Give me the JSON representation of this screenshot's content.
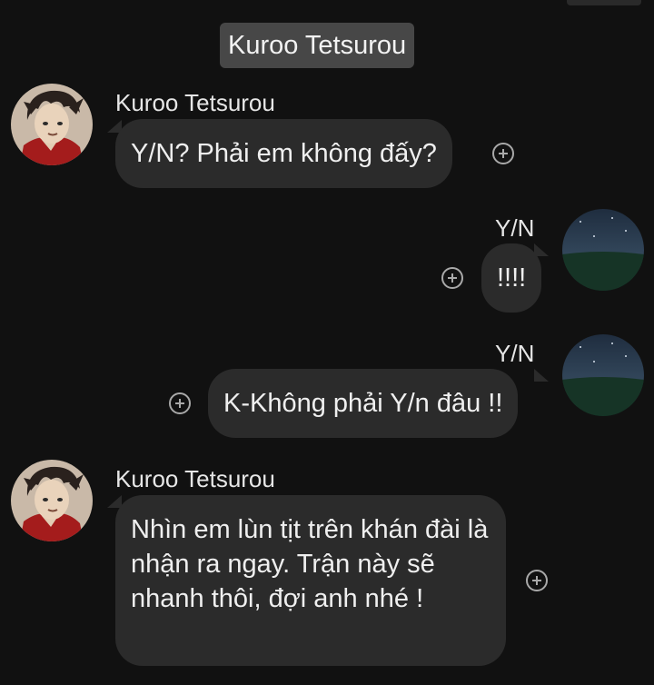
{
  "header": {
    "title": "Kuroo Tetsurou"
  },
  "messages": [
    {
      "sender": "Kuroo Tetsurou",
      "text": "Y/N? Phải em không đấy?",
      "side": "left",
      "avatar_icon": "kuroo-avatar-icon"
    },
    {
      "sender": "Y/N",
      "text": "!!!!",
      "side": "right",
      "avatar_icon": "night-sky-avatar-icon"
    },
    {
      "sender": "Y/N",
      "text": "K-Không phải Y/n đâu !!",
      "side": "right",
      "avatar_icon": "night-sky-avatar-icon"
    },
    {
      "sender": "Kuroo Tetsurou",
      "text": "Nhìn em lùn tịt trên khán đài là nhận ra ngay. Trận này sẽ nhanh thôi, đợi anh nhé !",
      "side": "left",
      "avatar_icon": "kuroo-avatar-icon"
    }
  ],
  "colors": {
    "background": "#111111",
    "bubble": "#2b2b2b",
    "header_chip": "#474747",
    "text": "#efefef",
    "icon": "#a9a9a9"
  }
}
